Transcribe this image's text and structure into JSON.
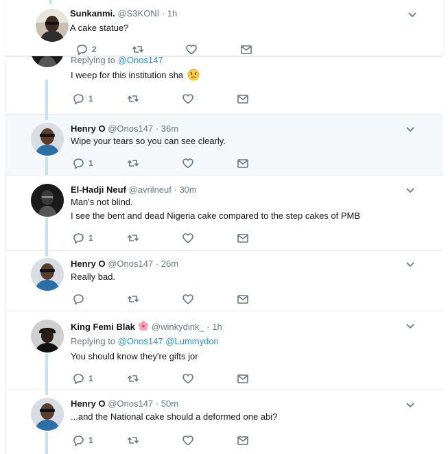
{
  "tweets": [
    {
      "name": "Sunkanmi.",
      "handle": "@S3KONI",
      "time": "· 1h",
      "text": "A cake statue?",
      "replies": "2",
      "avatar": "avatar-photo-man"
    },
    {
      "replying_prefix": "Replying to ",
      "replying_link": "@Onos147",
      "text": "I weep for this institution sha",
      "emoji": "worried-face-emoji",
      "replies": "1",
      "avatar": "avatar-dark-figure"
    },
    {
      "name": "Henry O",
      "handle": "@Onos147",
      "time": "· 36m",
      "text": "Wipe your tears so you can see clearly.",
      "replies": "1",
      "avatar": "avatar-man-sunglasses"
    },
    {
      "name": "El-Hadji Neuf",
      "handle": "@avrilneuf",
      "time": "· 30m",
      "text_lines": [
        "Man's not blind.",
        "I see the bent and dead Nigeria cake compared to the step cakes of PMB"
      ],
      "replies": "1",
      "avatar": "avatar-dark-figure"
    },
    {
      "name": "Henry O",
      "handle": "@Onos147",
      "time": "· 26m",
      "text": "Really bad.",
      "replies": "",
      "avatar": "avatar-man-sunglasses"
    },
    {
      "name": "King Femi Blak",
      "handle": "@winkydink_",
      "time": "· 1h",
      "name_emoji": "hibiscus-emoji",
      "replying_prefix": "Replying to ",
      "replying_links": [
        "@Onos147",
        "@Lummydon"
      ],
      "text": "You should know they're gifts jor",
      "replies": "1",
      "avatar": "avatar-man-cap"
    },
    {
      "name": "Henry O",
      "handle": "@Onos147",
      "time": "· 50m",
      "text": "...and the National cake should a deformed one abi?",
      "replies": "1",
      "avatar": "avatar-man-sunglasses"
    }
  ],
  "colors": {
    "accent": "#1b95e0",
    "muted": "#657786",
    "thread": "#c4e2f2",
    "highlight_bg": "#f5f8fa"
  }
}
